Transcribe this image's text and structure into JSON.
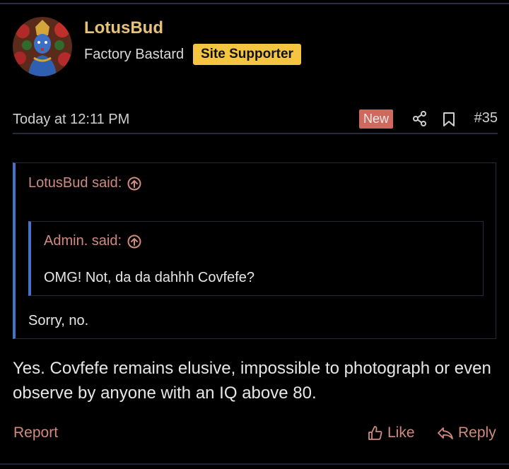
{
  "post": {
    "username": "LotusBud",
    "user_title": "Factory Bastard",
    "badge": "Site Supporter",
    "date": "Today at 12:11 PM",
    "new_label": "New",
    "post_number": "#35",
    "outer_quote": {
      "author": "LotusBud said:",
      "text": "Sorry, no."
    },
    "inner_quote": {
      "author": "Admin. said:",
      "text": "OMG! Not, da da dahhh Covfefe?"
    },
    "body": "Yes. Covfefe remains elusive, impossible to photograph or even observe by anyone with an IQ above 80.",
    "actions": {
      "report": "Report",
      "like": "Like",
      "reply": "Reply"
    }
  },
  "icons": {
    "avatar": "avatar-image",
    "share": "share-icon",
    "bookmark": "bookmark-icon",
    "quote_jump": "arrow-up-circle-icon",
    "like": "thumbs-up-icon",
    "reply": "reply-arrow-icon"
  },
  "colors": {
    "username": "#e6c27a",
    "badge_bg": "#f5c542",
    "link": "#d08a7e",
    "quote_border": "#4a72c4",
    "new_badge_bg": "#d0685e"
  }
}
